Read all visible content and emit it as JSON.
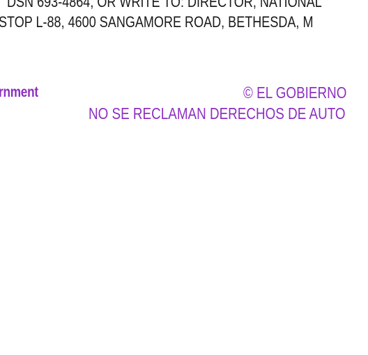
{
  "document": {
    "contact_line_1": "DSN 693-4864, OR WRITE TO: DIRECTOR, NATIONAL",
    "contact_line_2": "STOP L-88, 4600 SANGAMORE ROAD, BETHESDA, M",
    "government_fragment": "rnment",
    "copyright_notice": "© EL GOBIERNO",
    "rights_notice": "NO SE RECLAMAN DERECHOS DE AUTO"
  },
  "colors": {
    "text": "#1a1a1a",
    "accent": "#8d2fc1",
    "background": "#ffffff"
  }
}
